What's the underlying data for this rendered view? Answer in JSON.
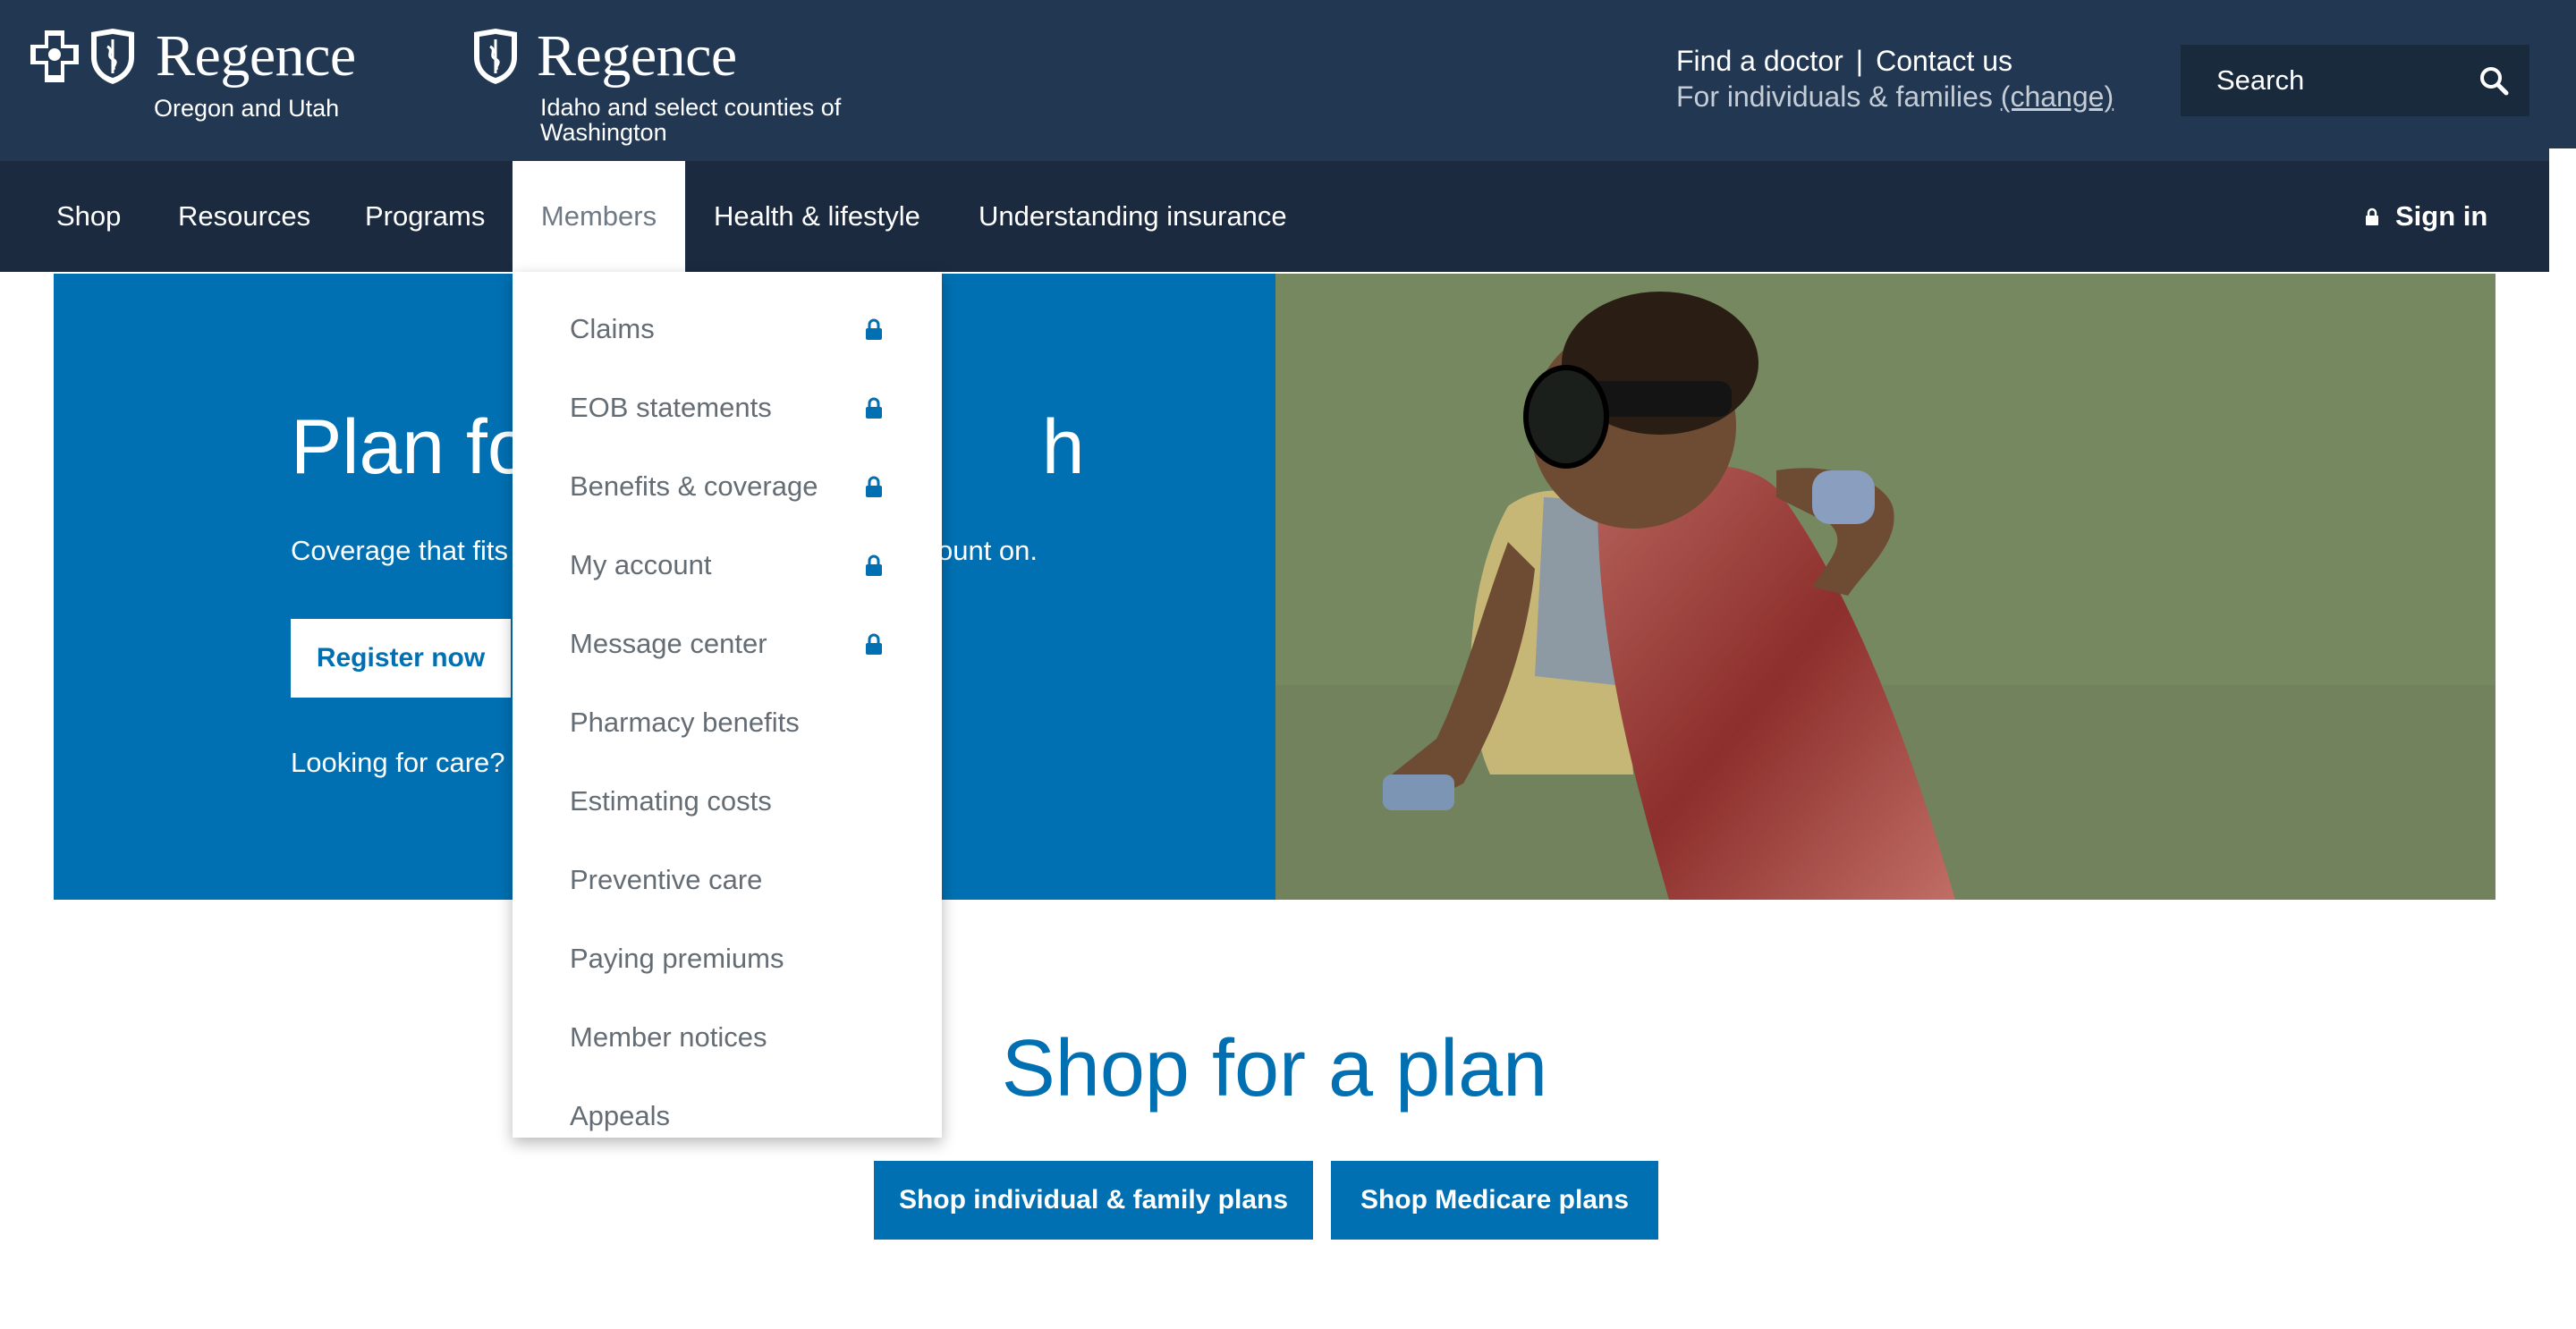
{
  "header": {
    "brands": [
      {
        "name": "Regence",
        "region": "Oregon and Utah"
      },
      {
        "name": "Regence",
        "region": "Idaho and select counties of Washington"
      }
    ],
    "utility": {
      "find_doctor": "Find a doctor",
      "separator": "|",
      "contact": "Contact us",
      "audience": "For individuals & families",
      "change": "(change)"
    },
    "search": {
      "placeholder": "Search",
      "icon": "search-icon"
    }
  },
  "nav": {
    "items": [
      "Shop",
      "Resources",
      "Programs",
      "Members",
      "Health & lifestyle",
      "Understanding insurance"
    ],
    "active": "Members",
    "signin": "Sign in"
  },
  "members_menu": {
    "items": [
      {
        "label": "Claims",
        "locked": true
      },
      {
        "label": "EOB statements",
        "locked": true
      },
      {
        "label": "Benefits & coverage",
        "locked": true
      },
      {
        "label": "My account",
        "locked": true
      },
      {
        "label": "Message center",
        "locked": true
      },
      {
        "label": "Pharmacy benefits",
        "locked": false
      },
      {
        "label": "Estimating costs",
        "locked": false
      },
      {
        "label": "Preventive care",
        "locked": false
      },
      {
        "label": "Paying premiums",
        "locked": false
      },
      {
        "label": "Member notices",
        "locked": false
      },
      {
        "label": "Appeals",
        "locked": false
      }
    ]
  },
  "hero": {
    "title_visible": "Plan fo                    h",
    "title_left": "Plan fo",
    "title_right": "h",
    "subtitle_left": "Coverage that fits",
    "subtitle_right": "ount on.",
    "register": "Register now",
    "looking": "Looking for care?"
  },
  "shop": {
    "title": "Shop for a plan",
    "individual": "Shop individual & family plans",
    "medicare": "Shop Medicare plans"
  },
  "colors": {
    "header_bg": "#213752",
    "nav_bg": "#1b2a3f",
    "brand_blue": "#0070b2",
    "menu_text": "#646c74"
  }
}
